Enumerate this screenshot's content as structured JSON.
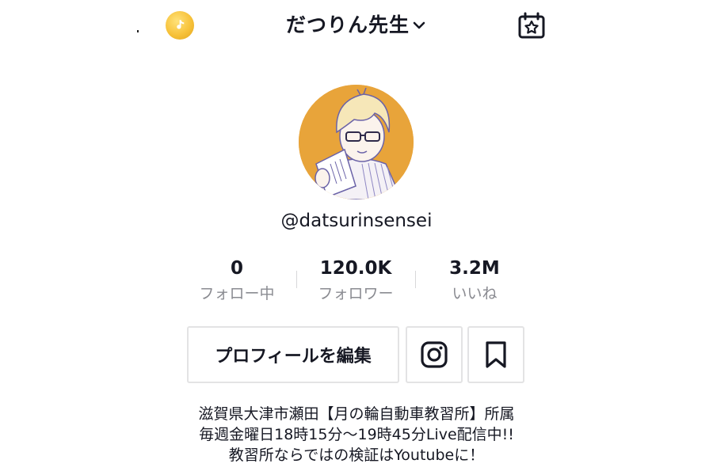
{
  "header": {
    "username_title": "だつりん先生",
    "icons": [
      "tiktok-coin-icon",
      "chevron-down-icon",
      "calendar-star-icon"
    ]
  },
  "profile": {
    "handle": "@datsurinsensei",
    "avatar_bg": "#e8a43a"
  },
  "stats": [
    {
      "value": "0",
      "label": "フォロー中"
    },
    {
      "value": "120.0K",
      "label": "フォロワー"
    },
    {
      "value": "3.2M",
      "label": "いいね"
    }
  ],
  "actions": {
    "edit_profile": "プロフィールを編集",
    "icons": [
      "instagram-icon",
      "bookmark-icon"
    ]
  },
  "bio": [
    "滋賀県大津市瀬田【月の輪自動車教習所】所属",
    "毎週金曜日18時15分〜19時45分Live配信中!!",
    "教習所ならではの検証はYoutubeに！"
  ],
  "colors": {
    "text": "#161823",
    "muted": "#8a8b91",
    "border": "#e3e3e4",
    "coin": "#f7c23a"
  }
}
